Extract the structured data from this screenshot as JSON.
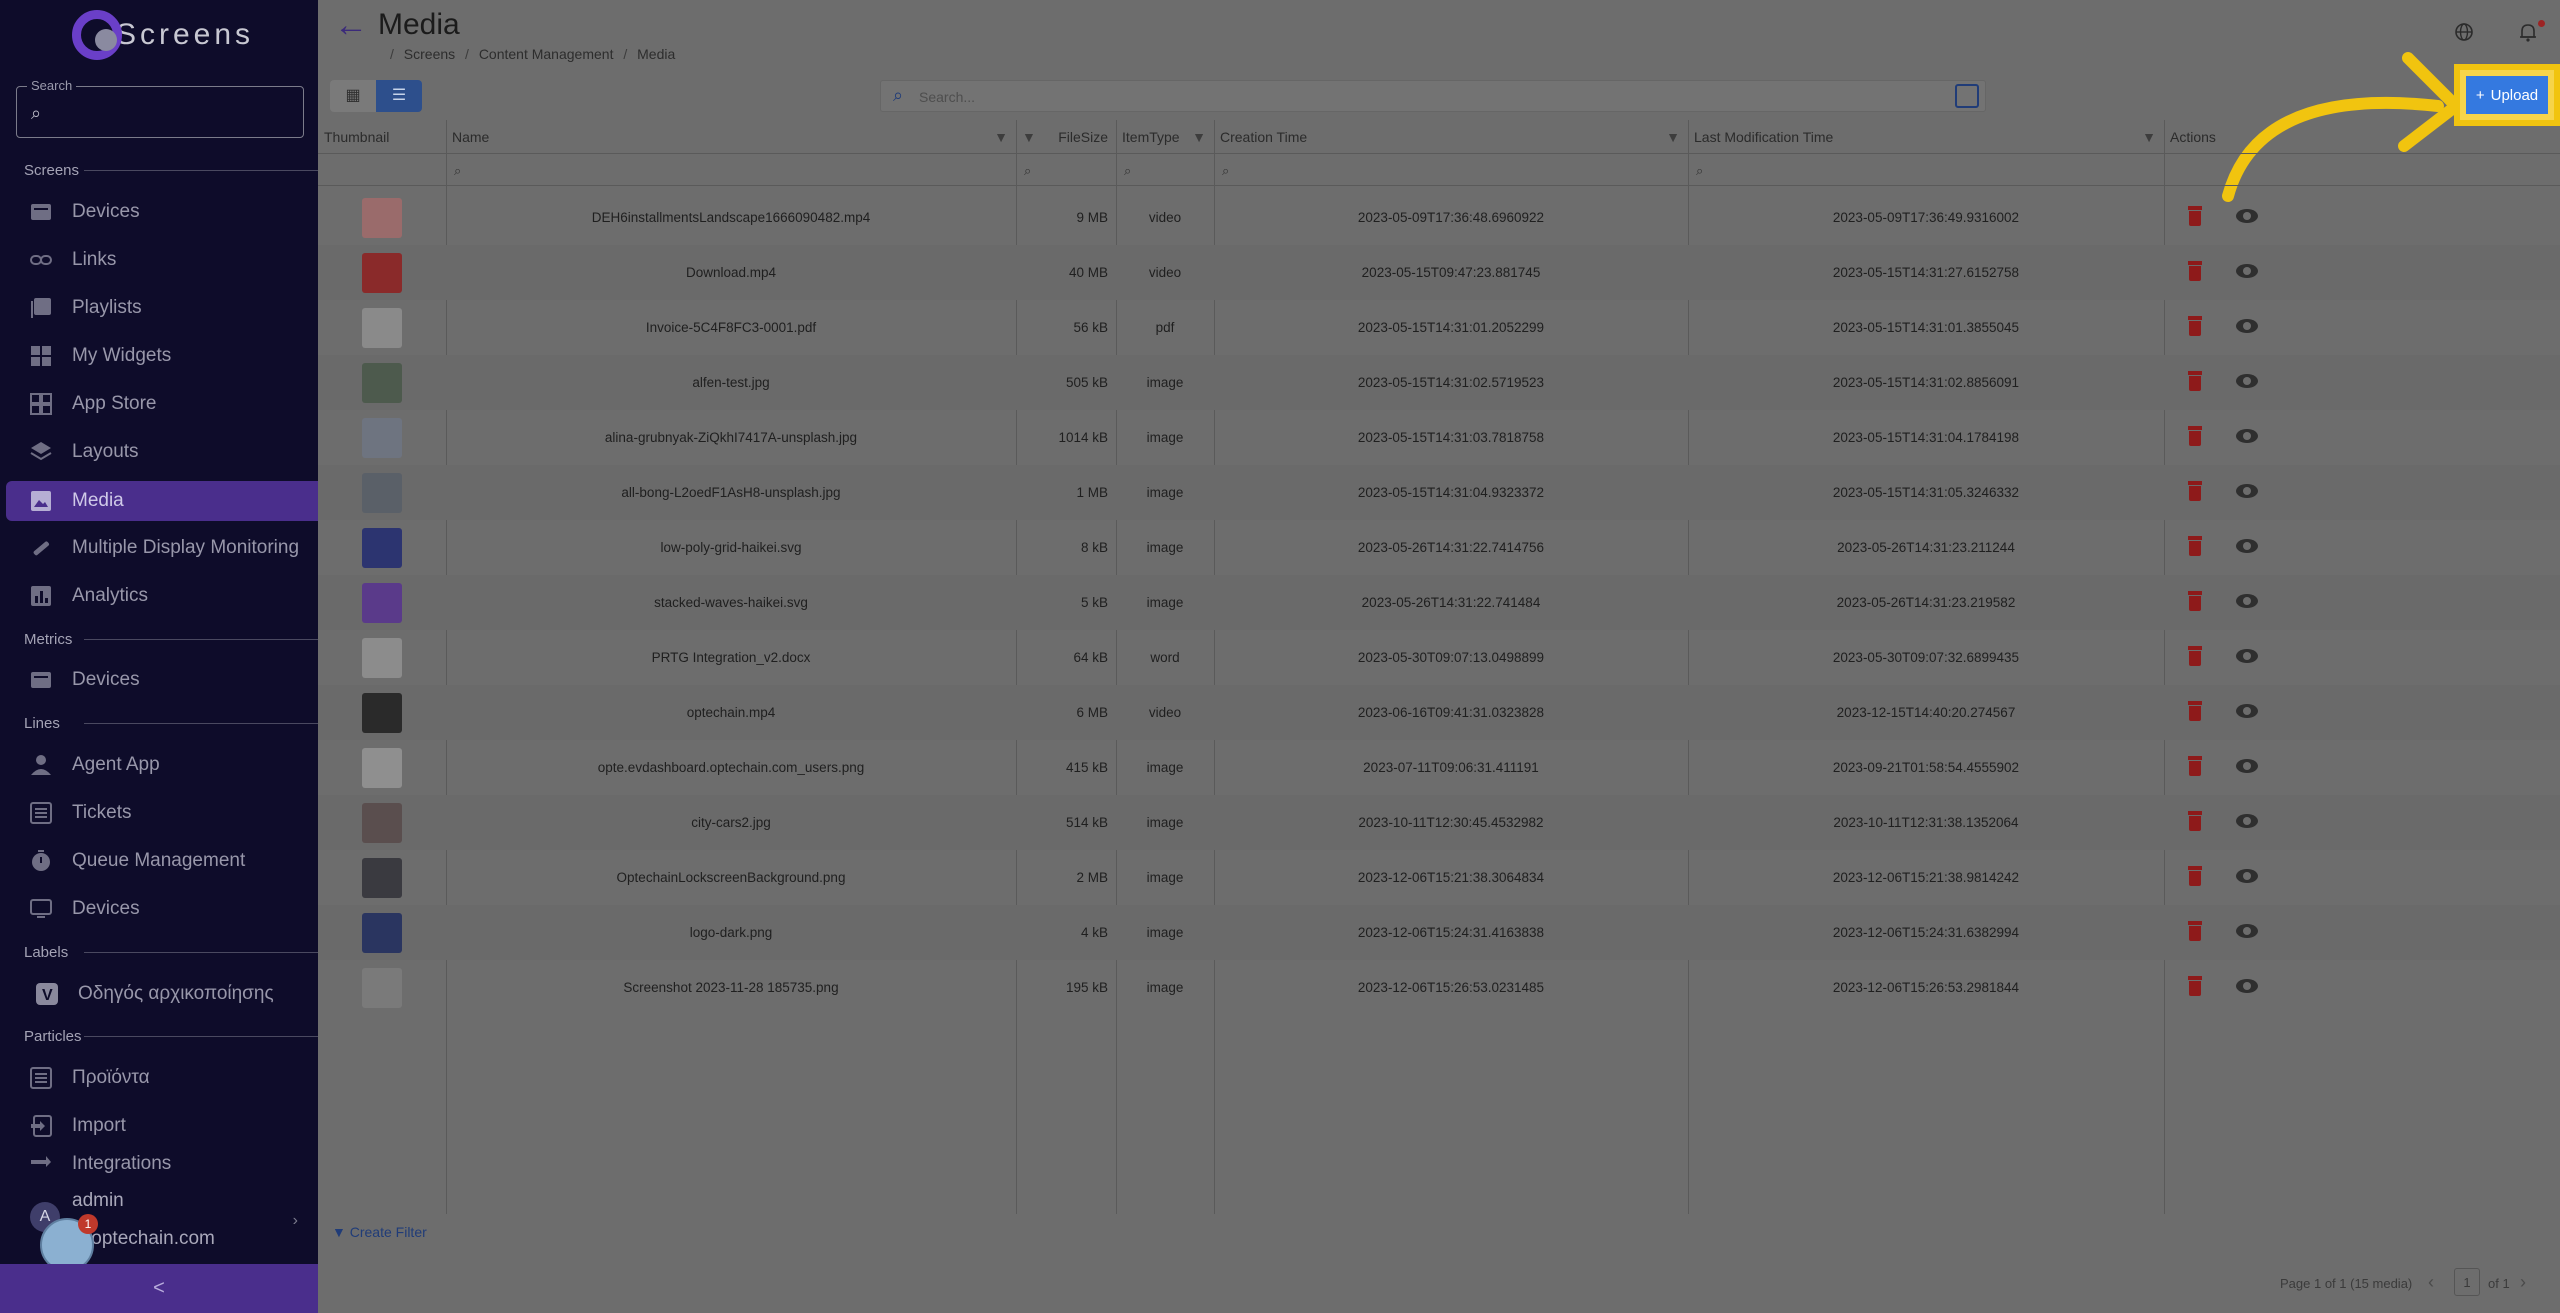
{
  "app": {
    "name": "Screens"
  },
  "sidebar": {
    "search_label": "Search",
    "sections": [
      {
        "label": "Screens"
      },
      {
        "label": "Metrics"
      },
      {
        "label": "Lines"
      },
      {
        "label": "Labels"
      },
      {
        "label": "Particles"
      }
    ],
    "items": [
      {
        "label": "Devices",
        "icon": "devices-icon"
      },
      {
        "label": "Links",
        "icon": "link-icon"
      },
      {
        "label": "Playlists",
        "icon": "playlist-icon"
      },
      {
        "label": "My Widgets",
        "icon": "widgets-icon"
      },
      {
        "label": "App Store",
        "icon": "app-store-icon"
      },
      {
        "label": "Layouts",
        "icon": "layers-icon"
      },
      {
        "label": "Media",
        "icon": "image-icon"
      },
      {
        "label": "Multiple Display Monitoring",
        "icon": "monitoring-icon"
      },
      {
        "label": "Analytics",
        "icon": "analytics-icon"
      },
      {
        "label": "Devices",
        "icon": "devices-icon"
      },
      {
        "label": "Agent App",
        "icon": "person-icon"
      },
      {
        "label": "Tickets",
        "icon": "tickets-icon"
      },
      {
        "label": "Queue Management",
        "icon": "timer-icon"
      },
      {
        "label": "Devices",
        "icon": "screen-icon"
      },
      {
        "label": "Οδηγός αρχικοποίησης",
        "icon": "v-badge-icon"
      },
      {
        "label": "Προϊόντα",
        "icon": "list-icon"
      },
      {
        "label": "Import",
        "icon": "import-icon"
      },
      {
        "label": "Integrations",
        "icon": "integrations-icon"
      }
    ],
    "user": {
      "initial": "A",
      "name": "admin",
      "email": "@optechain.com"
    },
    "bubble_badge": "1",
    "collapse_glyph": "<"
  },
  "header": {
    "title": "Media",
    "breadcrumb": [
      "Screens",
      "Content Management",
      "Media"
    ]
  },
  "toolbar": {
    "search_placeholder": "Search...",
    "upload_label": "Upload",
    "upload_plus": "+"
  },
  "table": {
    "columns": [
      "Thumbnail",
      "Name",
      "FileSize",
      "ItemType",
      "Creation Time",
      "Last Modification Time",
      "Actions"
    ],
    "rows": [
      {
        "name": "DEH6installmentsLandscape1666090482.mp4",
        "size": "9 MB",
        "type": "video",
        "created": "2023-05-09T17:36:48.6960922",
        "modified": "2023-05-09T17:36:49.9316002"
      },
      {
        "name": "Download.mp4",
        "size": "40 MB",
        "type": "video",
        "created": "2023-05-15T09:47:23.881745",
        "modified": "2023-05-15T14:31:27.6152758"
      },
      {
        "name": "Invoice-5C4F8FC3-0001.pdf",
        "size": "56 kB",
        "type": "pdf",
        "created": "2023-05-15T14:31:01.2052299",
        "modified": "2023-05-15T14:31:01.3855045"
      },
      {
        "name": "alfen-test.jpg",
        "size": "505 kB",
        "type": "image",
        "created": "2023-05-15T14:31:02.5719523",
        "modified": "2023-05-15T14:31:02.8856091"
      },
      {
        "name": "alina-grubnyak-ZiQkhI7417A-unsplash.jpg",
        "size": "1014 kB",
        "type": "image",
        "created": "2023-05-15T14:31:03.7818758",
        "modified": "2023-05-15T14:31:04.1784198"
      },
      {
        "name": "all-bong-L2oedF1AsH8-unsplash.jpg",
        "size": "1 MB",
        "type": "image",
        "created": "2023-05-15T14:31:04.9323372",
        "modified": "2023-05-15T14:31:05.3246332"
      },
      {
        "name": "low-poly-grid-haikei.svg",
        "size": "8 kB",
        "type": "image",
        "created": "2023-05-26T14:31:22.7414756",
        "modified": "2023-05-26T14:31:23.211244"
      },
      {
        "name": "stacked-waves-haikei.svg",
        "size": "5 kB",
        "type": "image",
        "created": "2023-05-26T14:31:22.741484",
        "modified": "2023-05-26T14:31:23.219582"
      },
      {
        "name": "PRTG Integration_v2.docx",
        "size": "64 kB",
        "type": "word",
        "created": "2023-05-30T09:07:13.0498899",
        "modified": "2023-05-30T09:07:32.6899435"
      },
      {
        "name": "optechain.mp4",
        "size": "6 MB",
        "type": "video",
        "created": "2023-06-16T09:41:31.0323828",
        "modified": "2023-12-15T14:40:20.274567"
      },
      {
        "name": "opte.evdashboard.optechain.com_users.png",
        "size": "415 kB",
        "type": "image",
        "created": "2023-07-11T09:06:31.411191",
        "modified": "2023-09-21T01:58:54.4555902"
      },
      {
        "name": "city-cars2.jpg",
        "size": "514 kB",
        "type": "image",
        "created": "2023-10-11T12:30:45.4532982",
        "modified": "2023-10-11T12:31:38.1352064"
      },
      {
        "name": "OptechainLockscreenBackground.png",
        "size": "2 MB",
        "type": "image",
        "created": "2023-12-06T15:21:38.3064834",
        "modified": "2023-12-06T15:21:38.9814242"
      },
      {
        "name": "logo-dark.png",
        "size": "4 kB",
        "type": "image",
        "created": "2023-12-06T15:24:31.4163838",
        "modified": "2023-12-06T15:24:31.6382994"
      },
      {
        "name": "Screenshot 2023-11-28 185735.png",
        "size": "195 kB",
        "type": "image",
        "created": "2023-12-06T15:26:53.0231485",
        "modified": "2023-12-06T15:26:53.2981844"
      }
    ]
  },
  "footer": {
    "create_filter": "Create Filter",
    "page_info": "Page 1 of 1 (15 media)",
    "page_number": "1",
    "page_of": "of 1"
  },
  "colors": {
    "sidebar_bg": "#0e0c2a",
    "accent": "#4a2e8c",
    "upload_button": "#3479e0",
    "highlight": "#f1c40f",
    "delete": "#8e1a1a"
  }
}
